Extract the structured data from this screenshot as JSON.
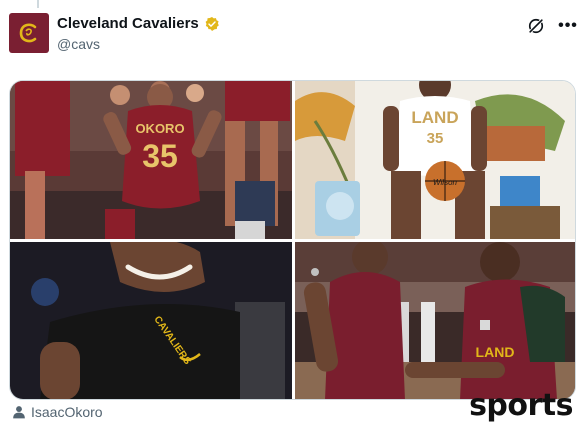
{
  "account": {
    "display_name": "Cleveland Cavaliers",
    "handle": "@cavs",
    "verified": true,
    "avatar_monogram": "C",
    "brand_color": "#7a1f32",
    "badge_color": "#e2b719"
  },
  "actions": {
    "grok_icon": "grok-slash-icon",
    "more_label": "•••"
  },
  "media": {
    "count": 4,
    "photos": [
      {
        "jersey_text": "OKORO",
        "jersey_number": "35"
      },
      {
        "jersey_text": "LAND",
        "jersey_number": "35",
        "ball_text": "Wilson"
      },
      {
        "jersey_text": "CAVALIERS",
        "jersey_number": ""
      },
      {
        "jersey_text": "LAND",
        "jersey_number": ""
      }
    ]
  },
  "tagged_user": {
    "icon": "person-icon",
    "name": "IsaacOkoro"
  },
  "watermark": "sports"
}
